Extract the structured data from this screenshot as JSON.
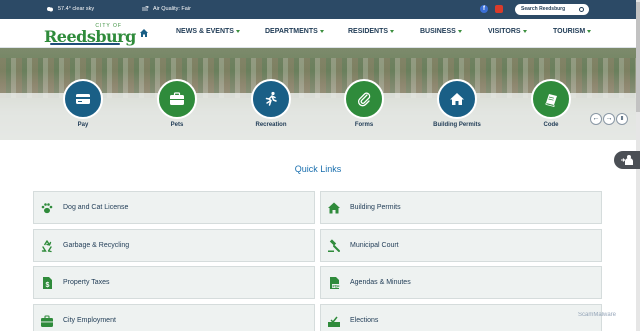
{
  "topbar": {
    "weather": "57.4° clear sky",
    "air_quality": "Air Quality: Fair",
    "search_label": "Search Reedsburg"
  },
  "logo": {
    "city_of": "CITY OF",
    "name": "Reedsburg"
  },
  "nav": {
    "items": [
      {
        "label": "NEWS & EVENTS"
      },
      {
        "label": "DEPARTMENTS"
      },
      {
        "label": "RESIDENTS"
      },
      {
        "label": "BUSINESS"
      },
      {
        "label": "VISITORS"
      },
      {
        "label": "TOURISM"
      }
    ]
  },
  "quick_icons": [
    {
      "label": "Pay",
      "icon": "credit-card-icon",
      "color": "#1a5f86"
    },
    {
      "label": "Pets",
      "icon": "briefcase-icon",
      "color": "#2f8b3b"
    },
    {
      "label": "Recreation",
      "icon": "running-person-icon",
      "color": "#1a5f86"
    },
    {
      "label": "Forms",
      "icon": "paperclip-icon",
      "color": "#2f8b3b"
    },
    {
      "label": "Building Permits",
      "icon": "home-icon",
      "color": "#1a5f86"
    },
    {
      "label": "Code",
      "icon": "book-icon",
      "color": "#2f8b3b"
    }
  ],
  "carousel": {
    "prev": "←",
    "next": "→",
    "pause": "II"
  },
  "quick_links": {
    "title": "Quick Links",
    "items": [
      {
        "label": "Dog and Cat License",
        "icon": "paw-icon"
      },
      {
        "label": "Building Permits",
        "icon": "home-icon"
      },
      {
        "label": "Garbage & Recycling",
        "icon": "recycle-icon"
      },
      {
        "label": "Municipal Court",
        "icon": "gavel-icon"
      },
      {
        "label": "Property Taxes",
        "icon": "dollar-document-icon"
      },
      {
        "label": "Agendas & Minutes",
        "icon": "pdf-document-icon"
      },
      {
        "label": "City Employment",
        "icon": "briefcase-icon"
      },
      {
        "label": "Elections",
        "icon": "ballot-check-icon"
      }
    ]
  },
  "watermark": "ScamMalware",
  "colors": {
    "primary": "#1f3b55",
    "green": "#2f8b3b",
    "blue": "#1a5f86",
    "accent_link": "#1a6fae"
  }
}
